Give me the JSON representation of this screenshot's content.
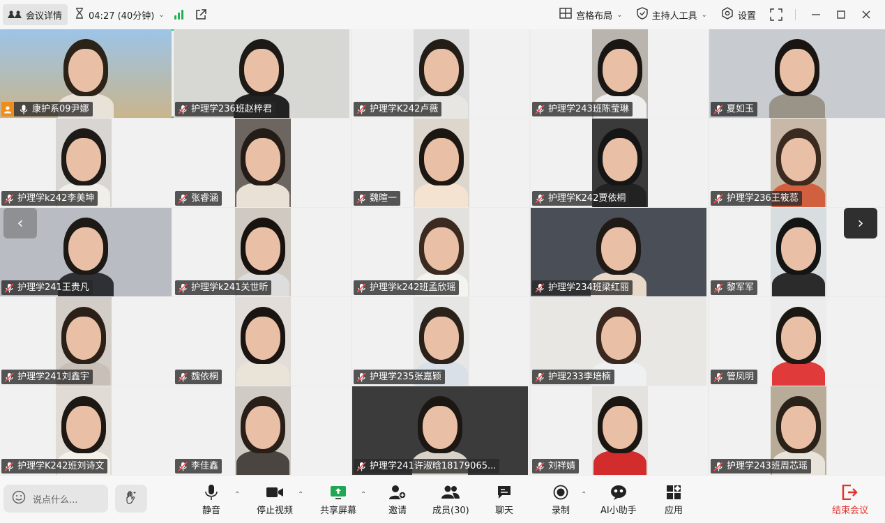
{
  "topbar": {
    "meeting_details": "会议详情",
    "timer": "04:27 (40分钟)",
    "layout": "宫格布局",
    "host_tools": "主持人工具",
    "settings": "设置"
  },
  "participants": [
    {
      "name": "康护系09尹娜",
      "host": true,
      "active": true
    },
    {
      "name": "护理学236班赵梓君"
    },
    {
      "name": "护理学K242卢薇"
    },
    {
      "name": "护理学243班陈莹琳"
    },
    {
      "name": "夏如玉"
    },
    {
      "name": "护理学k242李美坤"
    },
    {
      "name": "张睿涵"
    },
    {
      "name": "魏暄一"
    },
    {
      "name": "护理学K242贾依桐"
    },
    {
      "name": "护理学236王筱蕊"
    },
    {
      "name": "护理学241王贵凡"
    },
    {
      "name": "护理学k241关世昕"
    },
    {
      "name": "护理学k242班孟欣瑶"
    },
    {
      "name": "护理学234班梁红丽"
    },
    {
      "name": "黎军军"
    },
    {
      "name": "护理学241刘鑫宇"
    },
    {
      "name": "魏依桐"
    },
    {
      "name": "护理学235张嘉颖"
    },
    {
      "name": "护理233李培楠"
    },
    {
      "name": "管凤明"
    },
    {
      "name": "护理学K242班刘诗文"
    },
    {
      "name": "李佳鑫"
    },
    {
      "name": "护理学241许淑晗18179065..."
    },
    {
      "name": "刘祥婧"
    },
    {
      "name": "护理学243班周芯瑶"
    }
  ],
  "bottombar": {
    "chat_placeholder": "说点什么...",
    "mute": "静音",
    "stop_video": "停止视频",
    "share_screen": "共享屏幕",
    "invite": "邀请",
    "members": "成员(30)",
    "chat": "聊天",
    "record": "录制",
    "ai_assistant": "AI小助手",
    "apps": "应用",
    "end_meeting": "结束会议"
  },
  "colors": {
    "active_speaker_border": "#2ec27e",
    "signal": "#23b14d",
    "end_meeting": "#e3312d",
    "host_badge": "#f08c1a"
  }
}
